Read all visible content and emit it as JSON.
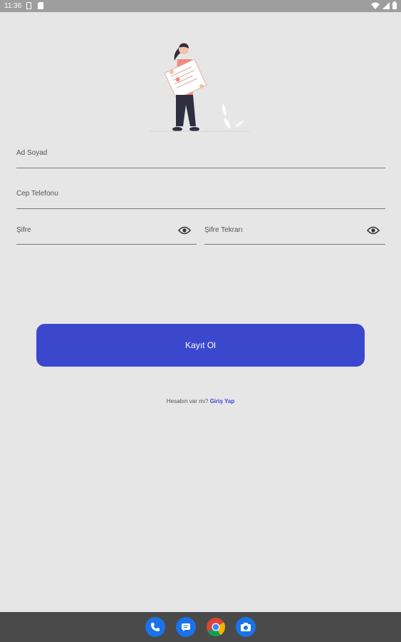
{
  "status_bar": {
    "time": "11:36",
    "icons": [
      "sim-icon",
      "sd-card-icon",
      "wifi-icon",
      "signal-icon",
      "battery-icon"
    ]
  },
  "form": {
    "name_label": "Ad Soyad",
    "phone_label": "Cep Telefonu",
    "password_label": "Şifre",
    "password_repeat_label": "Şifre Tekrarı"
  },
  "register_button_label": "Kayıt Ol",
  "login_prompt": {
    "text": "Hesabın var mı?",
    "link": "Giriş Yap"
  },
  "dock": [
    "phone-icon",
    "messages-icon",
    "chrome-icon",
    "camera-icon"
  ],
  "colors": {
    "accent": "#3b48cd",
    "background": "#e6e6e6",
    "status_bar": "#9e9e9e",
    "nav_bar": "#4a4a4a"
  }
}
